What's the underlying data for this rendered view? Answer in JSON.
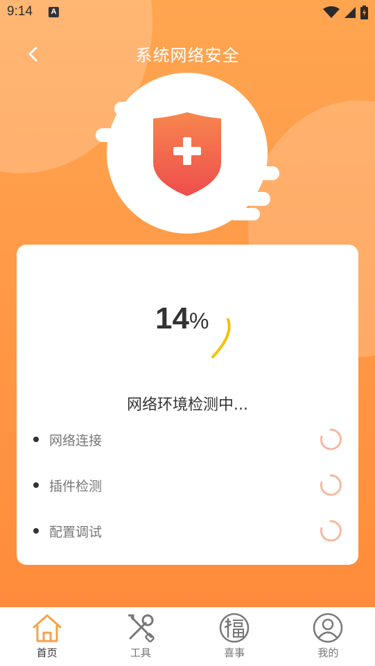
{
  "status_bar": {
    "time": "9:14",
    "notif_icon": "A"
  },
  "header": {
    "title": "系统网络安全",
    "back_icon": "chevron-left-icon"
  },
  "theme": {
    "accent": "#ff9a48",
    "shield_top": "#f7864e",
    "shield_bottom": "#ee4d4d",
    "arc_color": "#f2c200",
    "spinner_color": "#f5b8a0"
  },
  "scan": {
    "progress_value": "14",
    "progress_unit": "%",
    "status_text": "网络环境检测中...",
    "items": [
      {
        "label": "网络连接"
      },
      {
        "label": "插件检测"
      },
      {
        "label": "配置调试"
      }
    ]
  },
  "bottom_nav": {
    "items": [
      {
        "label": "首页",
        "icon": "home-icon",
        "active": true
      },
      {
        "label": "工具",
        "icon": "tools-icon",
        "active": false
      },
      {
        "label": "喜事",
        "icon": "fortune-icon",
        "active": false
      },
      {
        "label": "我的",
        "icon": "profile-icon",
        "active": false
      }
    ]
  }
}
